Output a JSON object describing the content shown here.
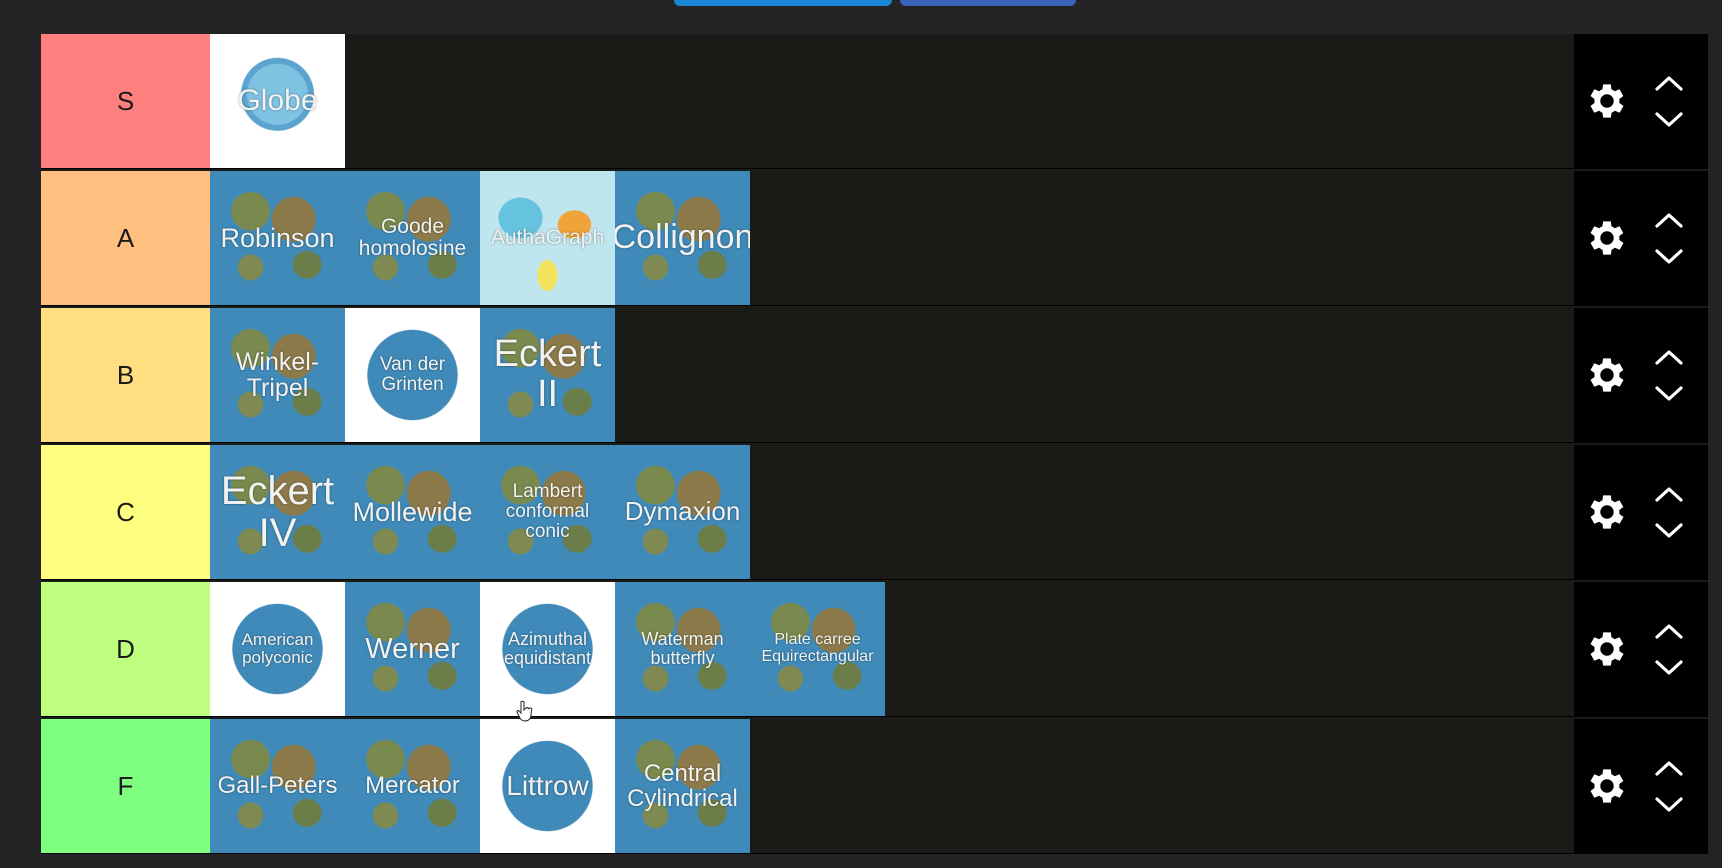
{
  "tiers": [
    {
      "label": "S",
      "color": "#ff7f7f",
      "items": [
        {
          "text": "Globe",
          "style": "globe",
          "size": 30
        }
      ]
    },
    {
      "label": "A",
      "color": "#ffbf7f",
      "items": [
        {
          "text": "Robinson",
          "style": "map",
          "size": 27
        },
        {
          "text": "Goode homolosine",
          "style": "map",
          "size": 21
        },
        {
          "text": "AuthaGraph",
          "style": "pale",
          "size": 21
        },
        {
          "text": "Collignon",
          "style": "map",
          "size": 34
        }
      ]
    },
    {
      "label": "B",
      "color": "#ffdf7f",
      "items": [
        {
          "text": "Winkel-Tripel",
          "style": "map",
          "size": 25
        },
        {
          "text": "Van der Grinten",
          "style": "circle",
          "size": 19
        },
        {
          "text": "Eckert II",
          "style": "map",
          "size": 38
        }
      ]
    },
    {
      "label": "C",
      "color": "#ffff7f",
      "items": [
        {
          "text": "Eckert IV",
          "style": "map",
          "size": 40
        },
        {
          "text": "Mollewide",
          "style": "map",
          "size": 27
        },
        {
          "text": "Lambert conformal conic",
          "style": "map",
          "size": 19
        },
        {
          "text": "Dymaxion",
          "style": "map",
          "size": 26
        }
      ]
    },
    {
      "label": "D",
      "color": "#bfff7f",
      "items": [
        {
          "text": "American polyconic",
          "style": "circle",
          "size": 17
        },
        {
          "text": "Werner",
          "style": "map",
          "size": 29
        },
        {
          "text": "Azimuthal equidistant",
          "style": "circle",
          "size": 18
        },
        {
          "text": "Waterman butterfly",
          "style": "map",
          "size": 18
        },
        {
          "text": "Plate carree Equirectangular",
          "style": "map",
          "size": 16
        }
      ]
    },
    {
      "label": "F",
      "color": "#7fff7f",
      "items": [
        {
          "text": "Gall-Peters",
          "style": "map",
          "size": 24
        },
        {
          "text": "Mercator",
          "style": "map",
          "size": 24
        },
        {
          "text": "Littrow",
          "style": "circle",
          "size": 28
        },
        {
          "text": "Central Cylindrical",
          "style": "map",
          "size": 24
        }
      ]
    }
  ],
  "icons": {
    "settings": "gear-icon",
    "up": "chevron-up-icon",
    "down": "chevron-down-icon"
  }
}
